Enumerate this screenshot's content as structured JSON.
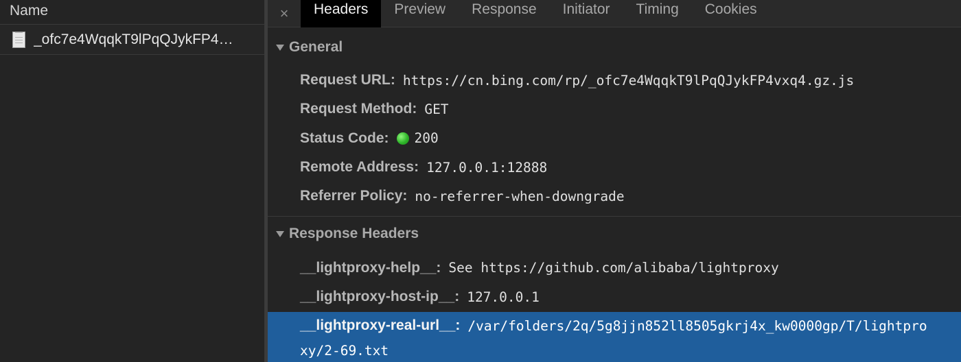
{
  "left_panel": {
    "header": "Name",
    "file_name": "_ofc7e4WqqkT9lPqQJykFP4…"
  },
  "tabs": {
    "close": "×",
    "items": [
      "Headers",
      "Preview",
      "Response",
      "Initiator",
      "Timing",
      "Cookies"
    ],
    "active": "Headers"
  },
  "general": {
    "title": "General",
    "request_url_key": "Request URL:",
    "request_url_val": "https://cn.bing.com/rp/_ofc7e4WqqkT9lPqQJykFP4vxq4.gz.js",
    "method_key": "Request Method:",
    "method_val": "GET",
    "status_key": "Status Code:",
    "status_val": "200",
    "status_color": "#2fb52a",
    "remote_key": "Remote Address:",
    "remote_val": "127.0.0.1:12888",
    "referrer_key": "Referrer Policy:",
    "referrer_val": "no-referrer-when-downgrade"
  },
  "response_headers": {
    "title": "Response Headers",
    "help_key": "__lightproxy-help__:",
    "help_val": "See https://github.com/alibaba/lightproxy",
    "host_key": "__lightproxy-host-ip__:",
    "host_val": "127.0.0.1",
    "real_url_key": "__lightproxy-real-url__:",
    "real_url_val_line1": "/var/folders/2q/5g8jjn852ll8505gkrj4x_kw0000gp/T/lightpro",
    "real_url_val_line2": "xy/2-69.txt",
    "highlight_color": "#1f5e9c"
  }
}
